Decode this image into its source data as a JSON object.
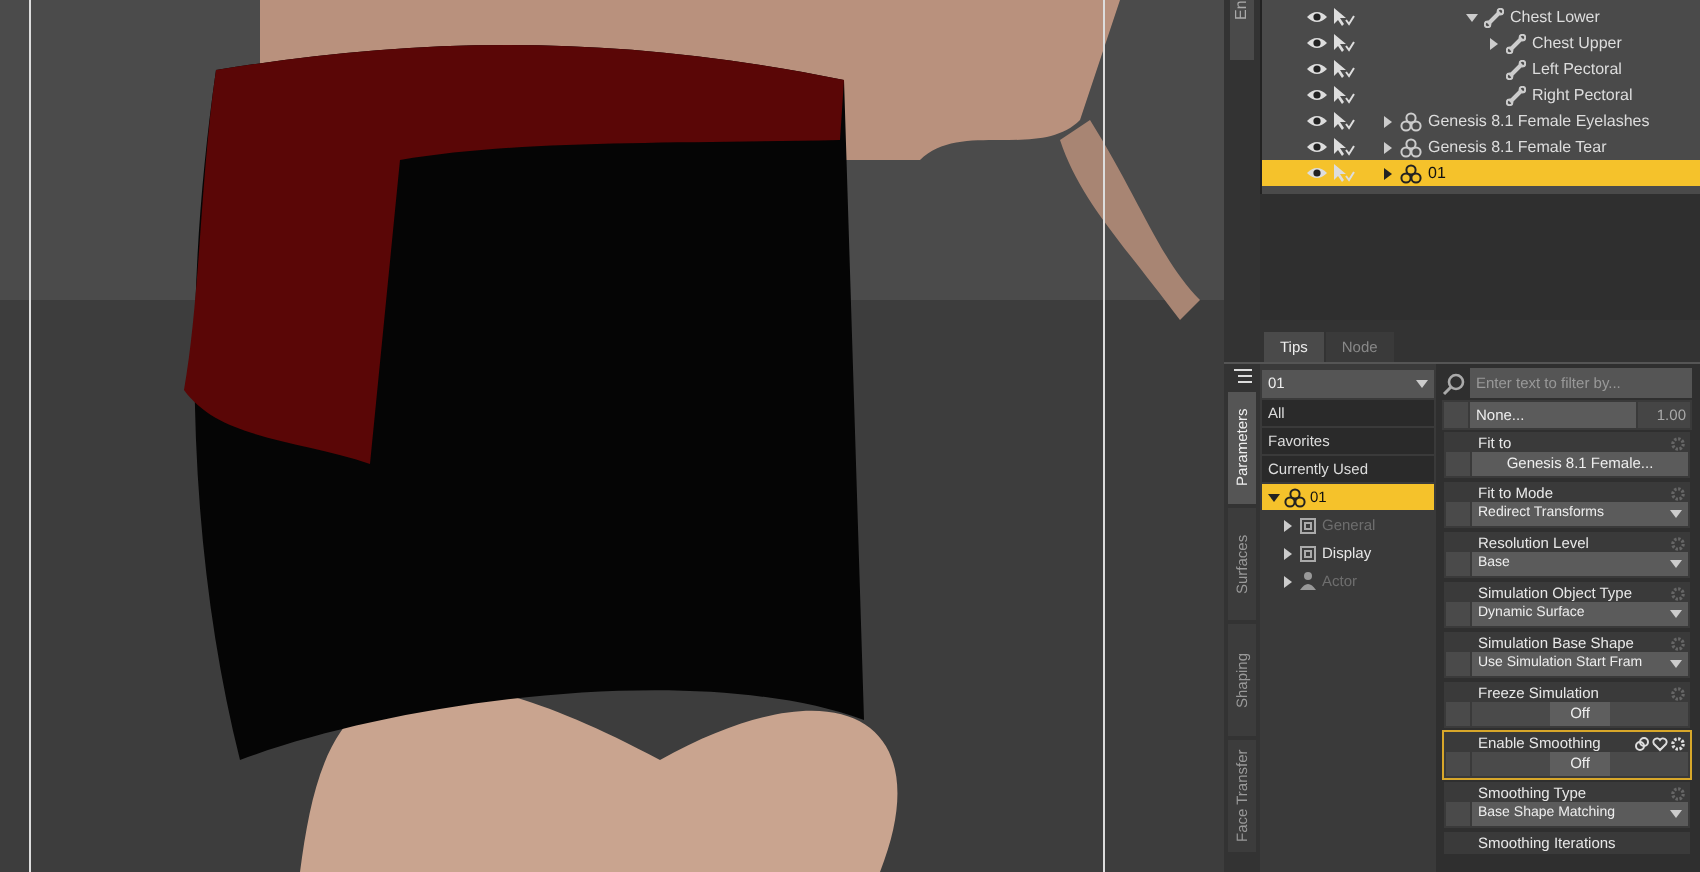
{
  "scene_tree": [
    {
      "label": "Chest Lower",
      "kind": "bone",
      "expandable": true,
      "expanded": true,
      "selected": false,
      "children": [
        {
          "label": "Chest Upper",
          "kind": "bone",
          "expandable": true,
          "expanded": false,
          "selected": false
        },
        {
          "label": "Left Pectoral",
          "kind": "bone",
          "expandable": false,
          "selected": false
        },
        {
          "label": "Right Pectoral",
          "kind": "bone",
          "expandable": false,
          "selected": false
        }
      ]
    },
    {
      "label": "Genesis 8.1 Female Eyelashes",
      "kind": "figure",
      "expandable": true,
      "expanded": false,
      "selected": false
    },
    {
      "label": "Genesis 8.1 Female Tear",
      "kind": "figure",
      "expandable": true,
      "expanded": false,
      "selected": false
    },
    {
      "label": "01",
      "kind": "figure",
      "expandable": true,
      "expanded": false,
      "selected": true
    }
  ],
  "top_side_tab": "En",
  "pane_tabs": [
    {
      "label": "Tips",
      "selected": true
    },
    {
      "label": "Node",
      "selected": false
    }
  ],
  "side_tabs": [
    {
      "label": "Parameters",
      "selected": true
    },
    {
      "label": "Surfaces",
      "selected": false
    },
    {
      "label": "Shaping",
      "selected": false
    },
    {
      "label": "Face Transfer",
      "selected": false
    }
  ],
  "node_selector": {
    "value": "01"
  },
  "group_list": [
    {
      "label": "All",
      "kind": "plain",
      "selected": false
    },
    {
      "label": "Favorites",
      "kind": "plain",
      "selected": false
    },
    {
      "label": "Currently Used",
      "kind": "plain",
      "selected": false
    },
    {
      "label": "01",
      "kind": "figure",
      "selected": true,
      "children": [
        {
          "label": "General",
          "kind": "group",
          "disabled": true
        },
        {
          "label": "Display",
          "kind": "group",
          "disabled": false
        },
        {
          "label": "Actor",
          "kind": "actor",
          "disabled": true
        }
      ]
    }
  ],
  "filter": {
    "placeholder": "Enter text to filter by..."
  },
  "preset": {
    "button": "None...",
    "value": "1.00"
  },
  "properties": [
    {
      "label": "Fit to",
      "kind": "button",
      "value": "Genesis 8.1 Female...",
      "selected": false
    },
    {
      "label": "Fit to Mode",
      "kind": "dropdown",
      "value": "Redirect Transforms",
      "selected": false
    },
    {
      "label": "Resolution Level",
      "kind": "dropdown",
      "value": "Base",
      "selected": false
    },
    {
      "label": "Simulation Object Type",
      "kind": "dropdown",
      "value": "Dynamic Surface",
      "selected": false
    },
    {
      "label": "Simulation Base Shape",
      "kind": "dropdown",
      "value": "Use Simulation Start Fram",
      "selected": false
    },
    {
      "label": "Freeze Simulation",
      "kind": "toggle",
      "value": "Off",
      "selected": false
    },
    {
      "label": "Enable Smoothing",
      "kind": "toggle",
      "value": "Off",
      "selected": true
    },
    {
      "label": "Smoothing Type",
      "kind": "dropdown",
      "value": "Base Shape Matching",
      "selected": false
    },
    {
      "label": "Smoothing Iterations",
      "kind": "cut",
      "selected": false
    }
  ]
}
